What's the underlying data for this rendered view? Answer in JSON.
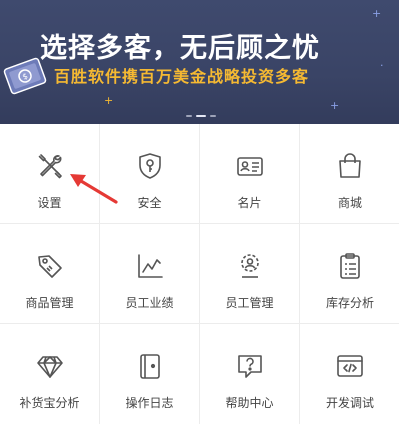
{
  "banner": {
    "headline": "选择多客，无后顾之忧",
    "subline": "百胜软件携百万美金战略投资多客",
    "colors": {
      "background": "#3f4a6e",
      "headline": "#ffffff",
      "subline": "#f5b932"
    },
    "carousel_active_index": 1,
    "carousel_dot_count": 3
  },
  "menu": {
    "items": [
      {
        "label": "设置",
        "icon": "wrench-screwdriver-icon"
      },
      {
        "label": "安全",
        "icon": "shield-key-icon"
      },
      {
        "label": "名片",
        "icon": "business-card-icon"
      },
      {
        "label": "商城",
        "icon": "shopping-bag-icon"
      },
      {
        "label": "商品管理",
        "icon": "price-tag-icon"
      },
      {
        "label": "员工业绩",
        "icon": "line-chart-icon"
      },
      {
        "label": "员工管理",
        "icon": "staff-gear-icon"
      },
      {
        "label": "库存分析",
        "icon": "clipboard-list-icon"
      },
      {
        "label": "补货宝分析",
        "icon": "diamond-icon"
      },
      {
        "label": "操作日志",
        "icon": "log-book-icon"
      },
      {
        "label": "帮助中心",
        "icon": "help-question-icon"
      },
      {
        "label": "开发调试",
        "icon": "code-window-icon"
      }
    ]
  },
  "annotation": {
    "arrow_color": "#e53935",
    "points_to": "设置"
  }
}
